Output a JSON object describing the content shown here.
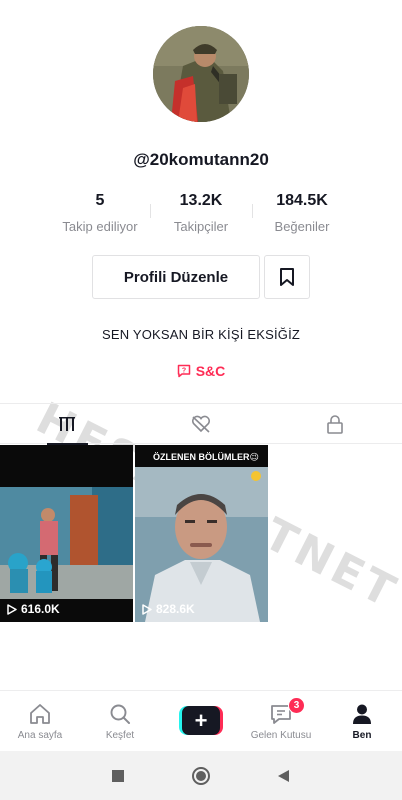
{
  "profile": {
    "username": "@20komutann20",
    "bio": "SEN YOKSAN BİR KİŞİ EKSİĞİZ",
    "link_label": "S&C",
    "edit_profile_label": "Profili Düzenle"
  },
  "stats": [
    {
      "value": "5",
      "label": "Takip ediliyor"
    },
    {
      "value": "13.2K",
      "label": "Takipçiler"
    },
    {
      "value": "184.5K",
      "label": "Beğeniler"
    }
  ],
  "watermark": "HESAPSATNET",
  "tabs": [
    {
      "icon": "grid-icon",
      "active": true
    },
    {
      "icon": "liked-hidden-icon",
      "active": false
    },
    {
      "icon": "lock-icon",
      "active": false
    }
  ],
  "videos": [
    {
      "views": "616.0K",
      "caption": ""
    },
    {
      "views": "828.6K",
      "caption": "ÖZLENEN BÖLÜMLER😉"
    }
  ],
  "bottom_nav": {
    "items": [
      {
        "label": "Ana sayfa",
        "icon": "home-icon"
      },
      {
        "label": "Keşfet",
        "icon": "search-icon"
      },
      {
        "label": "",
        "icon": "create-plus-icon"
      },
      {
        "label": "Gelen Kutusu",
        "icon": "inbox-icon",
        "badge": "3"
      },
      {
        "label": "Ben",
        "icon": "profile-icon",
        "active": true
      }
    ]
  },
  "colors": {
    "accent": "#fe2c55",
    "cyan": "#25f4ee",
    "text": "#161823",
    "muted": "#8a8b91"
  }
}
